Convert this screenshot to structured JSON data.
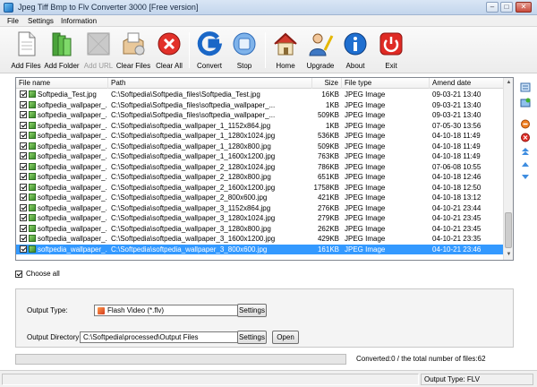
{
  "window": {
    "title": "Jpeg Tiff Bmp to Flv Converter 3000 [Free version]",
    "min": "–",
    "max": "□",
    "close": "✕"
  },
  "menu": [
    "File",
    "Settings",
    "Information"
  ],
  "toolbar": [
    {
      "label": "Add Files",
      "icon": "add-files-icon",
      "enabled": true
    },
    {
      "label": "Add Folder",
      "icon": "add-folder-icon",
      "enabled": true
    },
    {
      "label": "Add URL",
      "icon": "add-url-icon",
      "enabled": false
    },
    {
      "label": "Clear Files",
      "icon": "clear-files-icon",
      "enabled": true
    },
    {
      "label": "Clear All",
      "icon": "clear-all-icon",
      "enabled": true
    },
    {
      "label": "Convert",
      "icon": "convert-icon",
      "enabled": true
    },
    {
      "label": "Stop",
      "icon": "stop-icon",
      "enabled": true
    },
    {
      "label": "Home",
      "icon": "home-icon",
      "enabled": true
    },
    {
      "label": "Upgrade",
      "icon": "upgrade-icon",
      "enabled": true
    },
    {
      "label": "About",
      "icon": "about-icon",
      "enabled": true
    },
    {
      "label": "Exit",
      "icon": "exit-icon",
      "enabled": true
    }
  ],
  "list": {
    "columns": [
      "File name",
      "Path",
      "Size",
      "File type",
      "Amend date"
    ],
    "rows": [
      [
        "Softpedia_Test.jpg",
        "C:\\Softpedia\\Softpedia_files\\Softpedia_Test.jpg",
        "16KB",
        "JPEG Image",
        "09-03-21 13:40"
      ],
      [
        "softpedia_wallpaper_...",
        "C:\\Softpedia\\Softpedia_files\\softpedia_wallpaper_...",
        "1KB",
        "JPEG Image",
        "09-03-21 13:40"
      ],
      [
        "softpedia_wallpaper_...",
        "C:\\Softpedia\\Softpedia_files\\softpedia_wallpaper_...",
        "509KB",
        "JPEG Image",
        "09-03-21 13:40"
      ],
      [
        "softpedia_wallpaper_...",
        "C:\\Softpedia\\softpedia_wallpaper_1_1152x864.jpg",
        "1KB",
        "JPEG Image",
        "07-05-30 13:56"
      ],
      [
        "softpedia_wallpaper_...",
        "C:\\Softpedia\\softpedia_wallpaper_1_1280x1024.jpg",
        "536KB",
        "JPEG Image",
        "04-10-18 11:49"
      ],
      [
        "softpedia_wallpaper_...",
        "C:\\Softpedia\\softpedia_wallpaper_1_1280x800.jpg",
        "509KB",
        "JPEG Image",
        "04-10-18 11:49"
      ],
      [
        "softpedia_wallpaper_...",
        "C:\\Softpedia\\softpedia_wallpaper_1_1600x1200.jpg",
        "763KB",
        "JPEG Image",
        "04-10-18 11:49"
      ],
      [
        "softpedia_wallpaper_...",
        "C:\\Softpedia\\softpedia_wallpaper_2_1280x1024.jpg",
        "786KB",
        "JPEG Image",
        "07-06-08 10:55"
      ],
      [
        "softpedia_wallpaper_...",
        "C:\\Softpedia\\softpedia_wallpaper_2_1280x800.jpg",
        "651KB",
        "JPEG Image",
        "04-10-18 12:46"
      ],
      [
        "softpedia_wallpaper_...",
        "C:\\Softpedia\\softpedia_wallpaper_2_1600x1200.jpg",
        "1758KB",
        "JPEG Image",
        "04-10-18 12:50"
      ],
      [
        "softpedia_wallpaper_...",
        "C:\\Softpedia\\softpedia_wallpaper_2_800x600.jpg",
        "421KB",
        "JPEG Image",
        "04-10-18 13:12"
      ],
      [
        "softpedia_wallpaper_...",
        "C:\\Softpedia\\softpedia_wallpaper_3_1152x864.jpg",
        "276KB",
        "JPEG Image",
        "04-10-21 23:44"
      ],
      [
        "softpedia_wallpaper_...",
        "C:\\Softpedia\\softpedia_wallpaper_3_1280x1024.jpg",
        "279KB",
        "JPEG Image",
        "04-10-21 23:45"
      ],
      [
        "softpedia_wallpaper_...",
        "C:\\Softpedia\\softpedia_wallpaper_3_1280x800.jpg",
        "262KB",
        "JPEG Image",
        "04-10-21 23:45"
      ],
      [
        "softpedia_wallpaper_...",
        "C:\\Softpedia\\softpedia_wallpaper_3_1600x1200.jpg",
        "429KB",
        "JPEG Image",
        "04-10-21 23:35"
      ],
      [
        "softpedia_wallpaper_...",
        "C:\\Softpedia\\softpedia_wallpaper_3_800x600.jpg",
        "161KB",
        "JPEG Image",
        "04-10-21 23:46"
      ]
    ],
    "selected_index": 15
  },
  "choose_all": "Choose all",
  "output": {
    "type_label": "Output Type:",
    "type_value": "Flash Video (*.flv)",
    "settings_label": "Settings",
    "dir_label": "Output Directory:",
    "dir_value": "C:\\Softpedia\\processed\\Output Files",
    "dir_settings_label": "Settings",
    "open_label": "Open"
  },
  "progress": {
    "value": 0
  },
  "status": {
    "converted_text": "Converted:0  /  the total number of files:62",
    "output_type": "Output Type: FLV"
  },
  "colors": {
    "selection": "#3399ff",
    "accent": "#1a6fc0"
  }
}
